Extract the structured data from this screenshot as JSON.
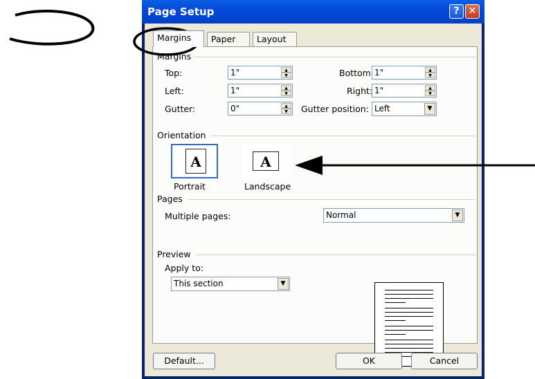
{
  "window": {
    "title": "Page Setup",
    "help": "?",
    "close": "✕"
  },
  "tabs": [
    {
      "label": "Margins"
    },
    {
      "label": "Paper"
    },
    {
      "label": "Layout"
    }
  ],
  "margins": {
    "group": "Margins",
    "top": {
      "label": "Top:",
      "value": "1\""
    },
    "bottom": {
      "label": "Bottom:",
      "value": "1\""
    },
    "left": {
      "label": "Left:",
      "value": "1\""
    },
    "right": {
      "label": "Right:",
      "value": "1\""
    },
    "gutter": {
      "label": "Gutter:",
      "value": "0\""
    },
    "gutter_position": {
      "label": "Gutter position:",
      "value": "Left"
    }
  },
  "orientation": {
    "group": "Orientation",
    "portrait": "Portrait",
    "landscape": "Landscape",
    "glyph": "A"
  },
  "pages": {
    "group": "Pages",
    "multiple_label": "Multiple pages:",
    "multiple_value": "Normal"
  },
  "preview": {
    "group": "Preview",
    "apply_label": "Apply to:",
    "apply_value": "This section"
  },
  "buttons": {
    "default": "Default...",
    "ok": "OK",
    "cancel": "Cancel"
  }
}
